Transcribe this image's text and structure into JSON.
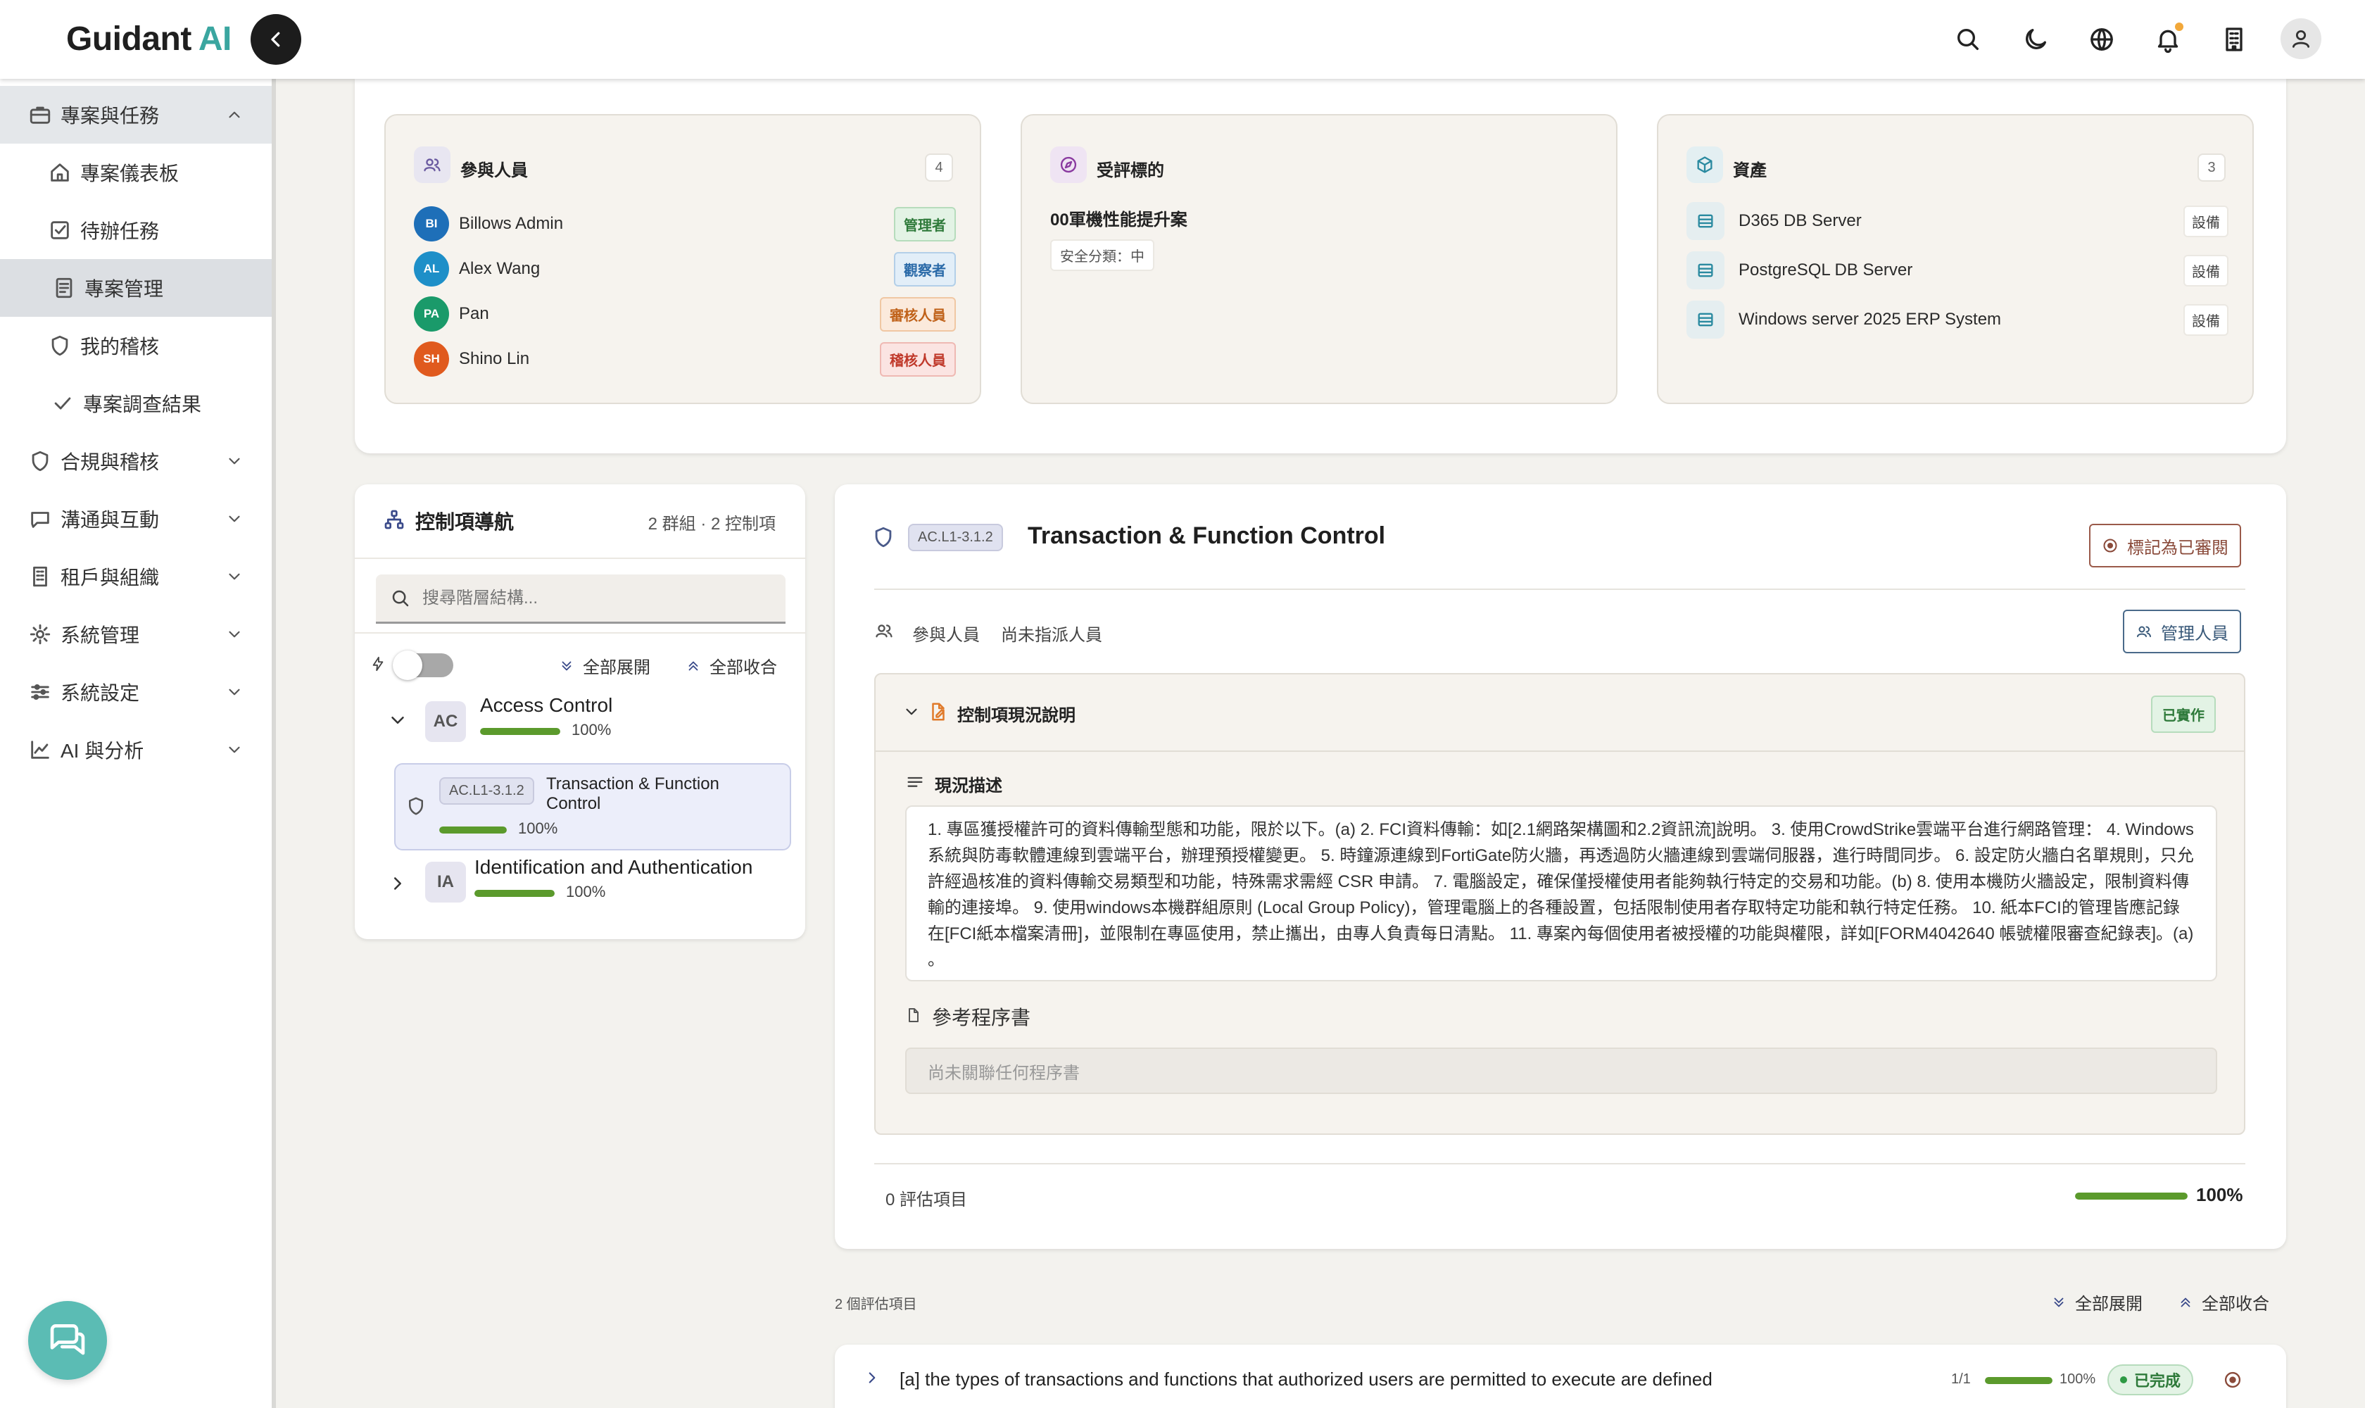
{
  "brand": {
    "name": "Guidant",
    "suffix": "AI"
  },
  "sidebar": {
    "items": [
      {
        "label": "專案與任務"
      },
      {
        "label": "專案儀表板"
      },
      {
        "label": "待辦任務"
      },
      {
        "label": "專案管理"
      },
      {
        "label": "我的稽核"
      },
      {
        "label": "專案調查結果"
      },
      {
        "label": "合規與稽核"
      },
      {
        "label": "溝通與互動"
      },
      {
        "label": "租戶與組織"
      },
      {
        "label": "系統管理"
      },
      {
        "label": "系統設定"
      },
      {
        "label": "AI 與分析"
      }
    ]
  },
  "participants": {
    "title": "參與人員",
    "count": "4",
    "people": [
      {
        "initials": "BI",
        "name": "Billows Admin",
        "role": "管理者",
        "avatar_color": "#1e6fb8"
      },
      {
        "initials": "AL",
        "name": "Alex Wang",
        "role": "觀察者",
        "avatar_color": "#1e8fc8"
      },
      {
        "initials": "PA",
        "name": "Pan",
        "role": "審核人員",
        "avatar_color": "#1a9a6a"
      },
      {
        "initials": "SH",
        "name": "Shino Lin",
        "role": "稽核人員",
        "avatar_color": "#e05a1e"
      }
    ]
  },
  "target": {
    "title": "受評標的",
    "name": "00軍機性能提升案",
    "classification": "安全分類：中"
  },
  "assets": {
    "title": "資產",
    "count": "3",
    "items": [
      {
        "name": "D365 DB Server",
        "tag": "設備"
      },
      {
        "name": "PostgreSQL DB Server",
        "tag": "設備"
      },
      {
        "name": "Windows server 2025 ERP System",
        "tag": "設備"
      }
    ]
  },
  "control_nav": {
    "title": "控制項導航",
    "summary": "2 群組 · 2 控制項",
    "search_placeholder": "搜尋階層結構...",
    "expand_all": "全部展開",
    "collapse_all": "全部收合",
    "groups": [
      {
        "code": "AC",
        "name": "Access Control",
        "pct": "100%",
        "progress": 1.0
      },
      {
        "code": "IA",
        "name": "Identification and Authentication",
        "pct": "100%",
        "progress": 1.0
      }
    ],
    "leaf": {
      "code": "AC.L1-3.1.2",
      "name": "Transaction & Function Control",
      "pct": "100%",
      "progress": 1.0
    }
  },
  "detail": {
    "code": "AC.L1-3.1.2",
    "title": "Transaction & Function Control",
    "mark_reviewed": "標記為已審閱",
    "participants_label": "參與人員",
    "participants_value": "尚未指派人員",
    "manage_people": "管理人員",
    "status_section": "控制項現況說明",
    "status_badge": "已實作",
    "desc_label": "現況描述",
    "description": "1. 專區獲授權許可的資料傳輸型態和功能，限於以下。(a) 2. FCI資料傳輸：如[2.1網路架構圖和2.2資訊流]說明。 3. 使用CrowdStrike雲端平台進行網路管理： 4. Windows系統與防毒軟體連線到雲端平台，辦理預授權變更。 5. 時鐘源連線到FortiGate防火牆，再透過防火牆連線到雲端伺服器，進行時間同步。 6. 設定防火牆白名單規則，只允許經過核准的資料傳輸交易類型和功能，特殊需求需經 CSR 申請。 7. 電腦設定，確保僅授權使用者能夠執行特定的交易和功能。(b) 8. 使用本機防火牆設定，限制資料傳輸的連接埠。 9. 使用windows本機群組原則 (Local Group Policy)，管理電腦上的各種設置，包括限制使用者存取特定功能和執行特定任務。 10. 紙本FCI的管理皆應記錄在[FCI紙本檔案清冊]，並限制在專區使用，禁止攜出，由專人負責每日清點。 11. 專案內每個使用者被授權的功能與權限，詳如[FORM4042640 帳號權限審查紀錄表]。(a) 。",
    "procedure_label": "參考程序書",
    "procedure_empty": "尚未關聯任何程序書",
    "eval_count": "0 評估項目",
    "overall_pct": "100%",
    "overall_progress": 1.0
  },
  "assessment": {
    "count_label": "2 個評估項目",
    "expand_all": "全部展開",
    "collapse_all": "全部收合",
    "items": [
      {
        "text": "[a] the types of transactions and functions that authorized users are permitted to execute are defined",
        "ratio": "1/1",
        "pct": "100%",
        "progress": 1.0,
        "status": "已完成"
      }
    ]
  },
  "colors": {
    "accent": "#3aa6a0",
    "progress": "#5b9a2c",
    "mark_btn": "#9a5a4a",
    "manage_btn": "#4a6a8a"
  }
}
